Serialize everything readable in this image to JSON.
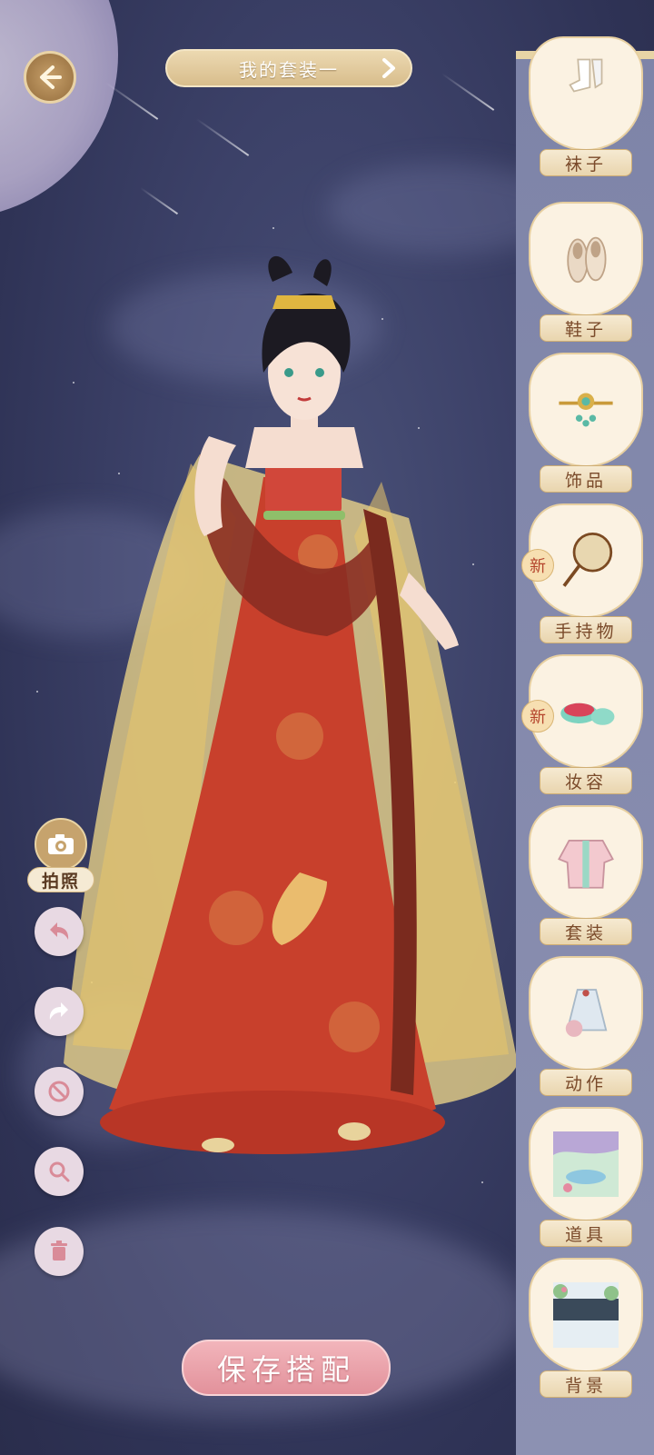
{
  "header": {
    "outfit_name": "我的套装一"
  },
  "categories": [
    {
      "label": "袜子",
      "icon": "socks-icon",
      "is_new": false
    },
    {
      "label": "鞋子",
      "icon": "shoes-icon",
      "is_new": false
    },
    {
      "label": "饰品",
      "icon": "hairpin-icon",
      "is_new": false
    },
    {
      "label": "手持物",
      "icon": "fan-icon",
      "is_new": true,
      "new_label": "新"
    },
    {
      "label": "妆容",
      "icon": "makeup-icon",
      "is_new": true,
      "new_label": "新"
    },
    {
      "label": "套装",
      "icon": "outfit-icon",
      "is_new": false
    },
    {
      "label": "动作",
      "icon": "pose-icon",
      "is_new": false
    },
    {
      "label": "道具",
      "icon": "scenery-icon",
      "is_new": false
    },
    {
      "label": "背景",
      "icon": "background-icon",
      "is_new": false
    }
  ],
  "tools": {
    "photo_label": "拍照"
  },
  "save_button": {
    "label": "保存搭配"
  },
  "colors": {
    "sky": "#3c4168",
    "gold": "#c6a36d",
    "panel": "#8388ab",
    "save_pink": "#e8a2ab",
    "label_text": "#7a4a2a"
  }
}
